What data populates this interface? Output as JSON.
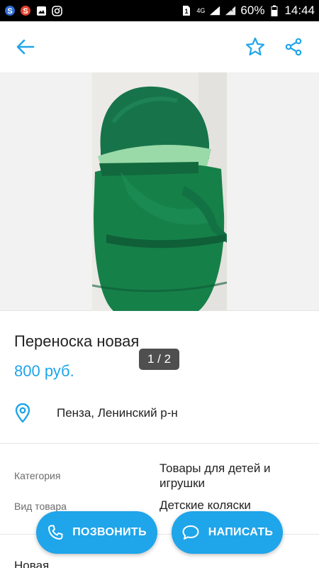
{
  "status_bar": {
    "network": "4G",
    "battery": "60%",
    "time": "14:44",
    "icons": [
      "s-app-icon",
      "s-app-icon-red",
      "gallery-icon",
      "instagram-icon",
      "sim-icon",
      "signal-icon",
      "battery-icon"
    ]
  },
  "app_bar": {
    "icons": [
      "back-arrow-icon",
      "star-icon",
      "share-icon"
    ],
    "accent": "#1fa5ea"
  },
  "gallery": {
    "counter": "1 / 2"
  },
  "listing": {
    "title": "Переноска новая",
    "price": "800 руб.",
    "location": "Пенза, Ленинский р-н"
  },
  "params": [
    {
      "label": "Категория",
      "value": "Товары для детей и игрушки"
    },
    {
      "label": "Вид товара",
      "value": "Детские коляски"
    }
  ],
  "description": "Новая.",
  "actions": {
    "call_label": "ПОЗВОНИТЬ",
    "write_label": "НАПИСАТЬ"
  }
}
